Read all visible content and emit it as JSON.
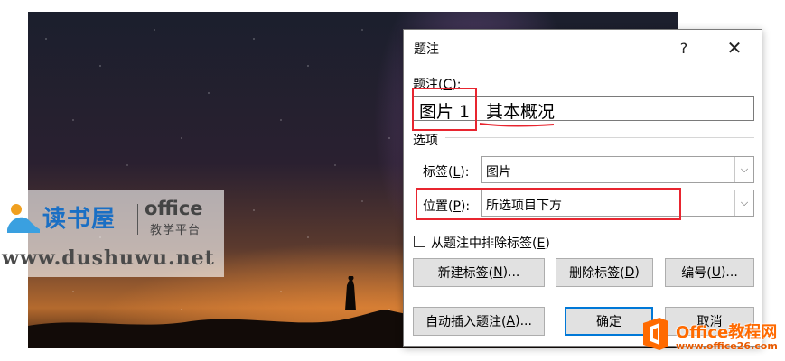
{
  "dialog": {
    "title": "题注",
    "help_glyph": "?",
    "close_glyph": "✕",
    "caption_label": "题注(",
    "caption_label_key": "C",
    "caption_label_end": "):",
    "caption_prefix": "图片 1",
    "caption_text": "其本概况",
    "options_label": "选项",
    "label_label": "标签(",
    "label_key": "L",
    "label_end": "):",
    "label_value": "图片",
    "position_label": "位置(",
    "position_key": "P",
    "position_end": "):",
    "position_value": "所选项目下方",
    "exclude_label": "从题注中排除标签(",
    "exclude_key": "E",
    "exclude_end": ")",
    "exclude_checked": false,
    "buttons": {
      "new_label": "新建标签(",
      "new_label_key": "N",
      "new_label_end": ")...",
      "delete_label": "删除标签(",
      "delete_label_key": "D",
      "delete_label_end": ")",
      "numbering": "编号(",
      "numbering_key": "U",
      "numbering_end": ")...",
      "autocaption": "自动插入题注(",
      "autocaption_key": "A",
      "autocaption_end": ")...",
      "ok": "确定",
      "cancel": "取消"
    }
  },
  "watermarks": {
    "left_brand": "读书屋",
    "left_office": "office",
    "left_sub": "教学平台",
    "left_url": "www.dushuwu.net",
    "right_title": "Office教程网",
    "right_url": "www.office26.com"
  },
  "colors": {
    "annotation": "#e8252f",
    "ok_border": "#0078d7",
    "brand_orange": "#ff6a00"
  }
}
